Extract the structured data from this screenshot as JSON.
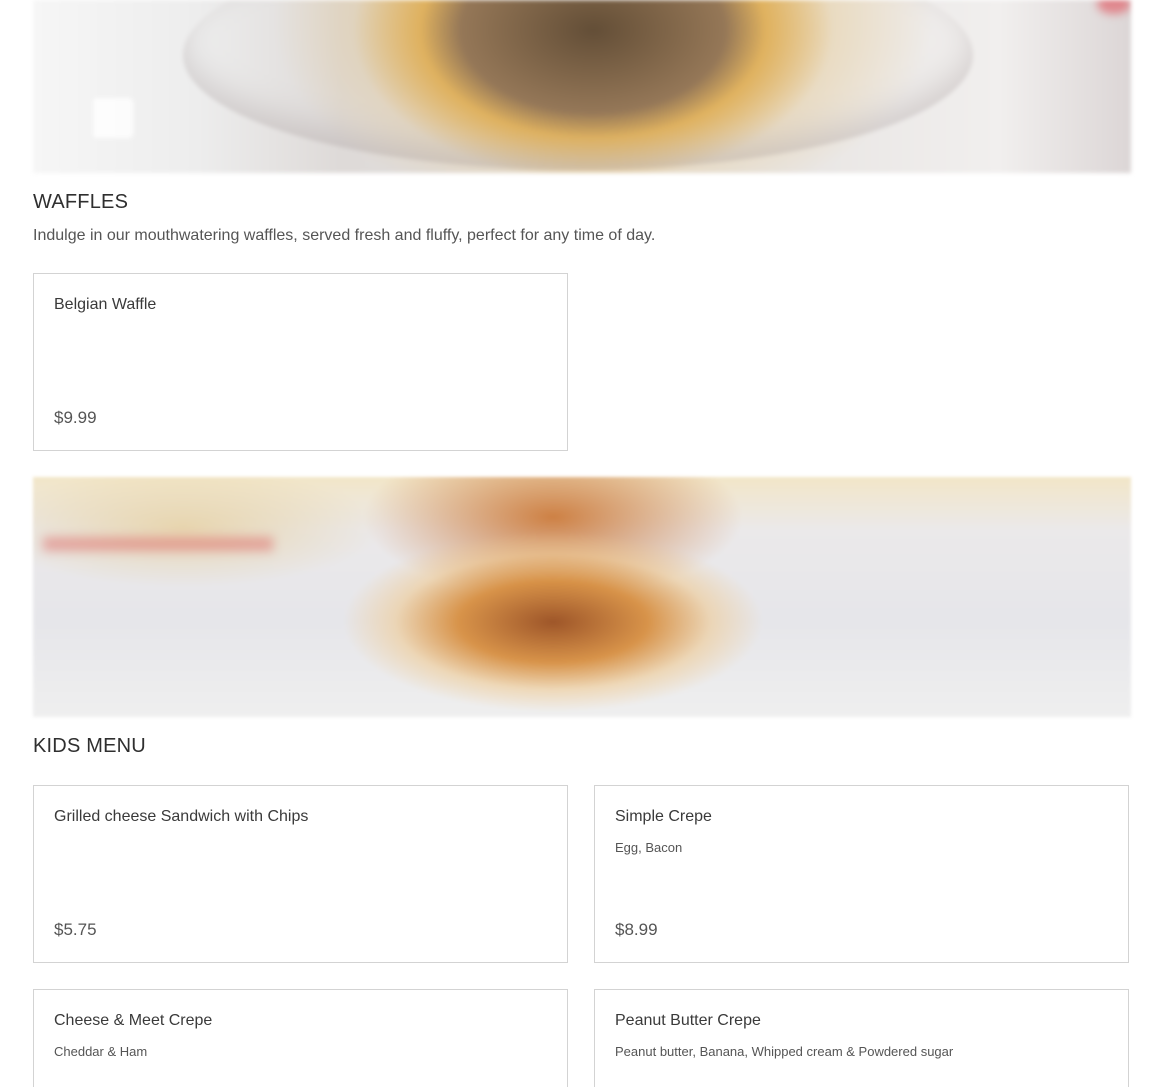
{
  "sections": {
    "waffles": {
      "title": "WAFFLES",
      "description": "Indulge in our mouthwatering waffles, served fresh and fluffy, perfect for any time of day.",
      "items": [
        {
          "name": "Belgian Waffle",
          "description": "",
          "price": "$9.99"
        }
      ]
    },
    "kids": {
      "title": "KIDS MENU",
      "items": [
        {
          "name": "Grilled cheese Sandwich with Chips",
          "description": "",
          "price": "$5.75"
        },
        {
          "name": "Simple Crepe",
          "description": "Egg, Bacon",
          "price": "$8.99"
        },
        {
          "name": "Cheese & Meet Crepe",
          "description": "Cheddar & Ham",
          "price": ""
        },
        {
          "name": "Peanut Butter Crepe",
          "description": "Peanut butter, Banana, Whipped cream & Powdered sugar",
          "price": ""
        }
      ]
    }
  }
}
